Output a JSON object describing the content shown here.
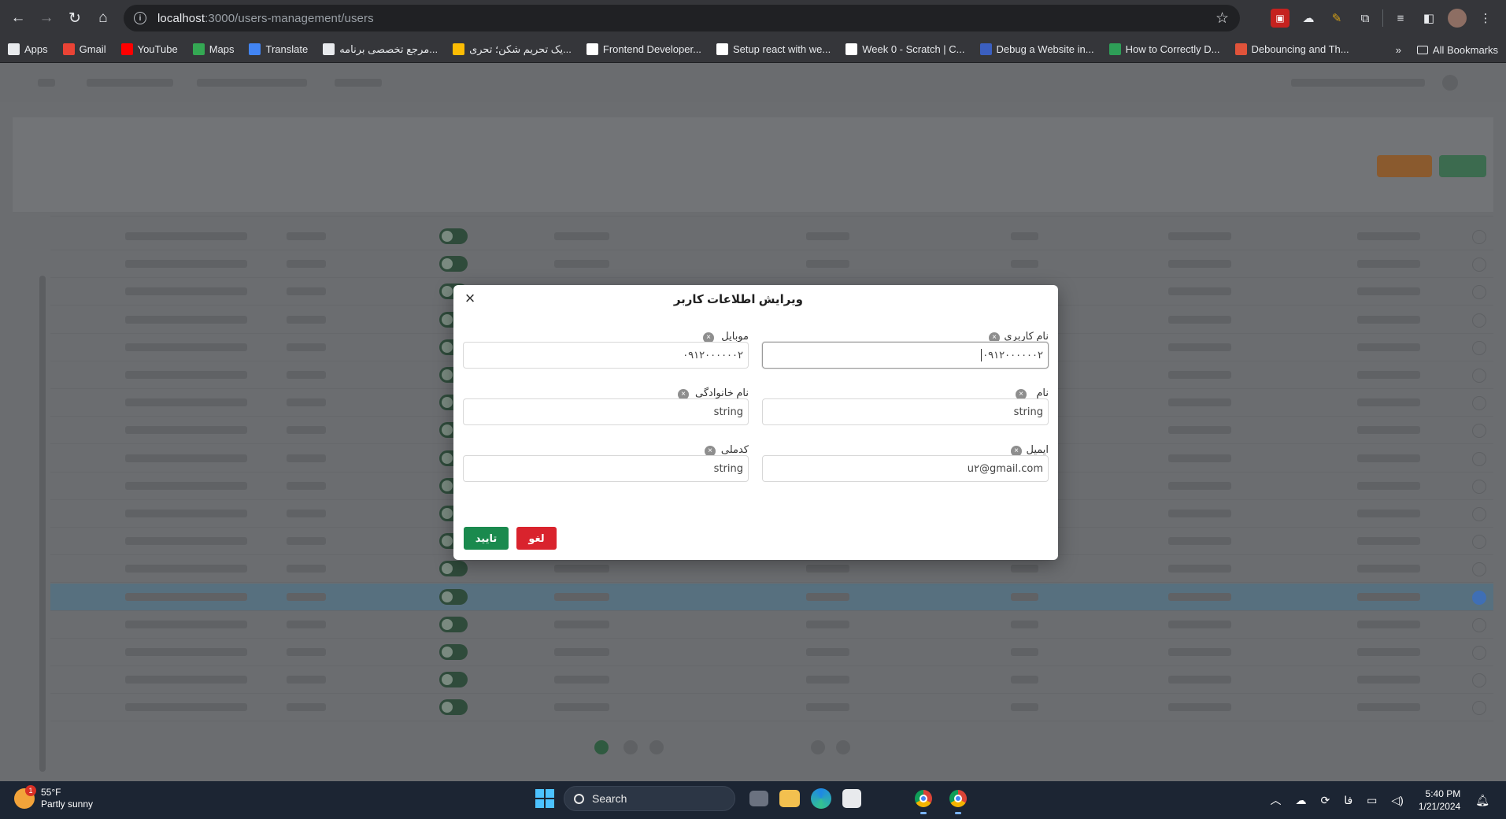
{
  "browser": {
    "url_host": "localhost",
    "url_path": ":3000/users-management/users",
    "nav": {
      "back": "←",
      "forward": "→",
      "reload": "↻",
      "home": "⌂"
    },
    "bookmarks": [
      {
        "label": "Apps",
        "icon": "apps-grid-icon",
        "color": "#e8eaed"
      },
      {
        "label": "Gmail",
        "icon": "gmail-icon",
        "color": "#ea4335"
      },
      {
        "label": "YouTube",
        "icon": "youtube-icon",
        "color": "#ff0000"
      },
      {
        "label": "Maps",
        "icon": "maps-icon",
        "color": "#34a853"
      },
      {
        "label": "Translate",
        "icon": "translate-icon",
        "color": "#4285f4"
      },
      {
        "label": "مرجع تخصصی برنامه...",
        "icon": "site-icon",
        "color": "#e8eaed"
      },
      {
        "label": "یک تحریم شکن؛ تحری...",
        "icon": "site-icon",
        "color": "#fbbc04"
      },
      {
        "label": "Frontend Developer...",
        "icon": "frontend-icon",
        "color": "#ffffff"
      },
      {
        "label": "Setup react with we...",
        "icon": "medium-icon",
        "color": "#ffffff"
      },
      {
        "label": "Week 0 - Scratch | C...",
        "icon": "x-icon",
        "color": "#ffffff"
      },
      {
        "label": "Debug a Website in...",
        "icon": "wd-icon",
        "color": "#3b5fc0"
      },
      {
        "label": "How to Correctly D...",
        "icon": "dp-icon",
        "color": "#2e9e57"
      },
      {
        "label": "Debouncing and Th...",
        "icon": "asterisk-icon",
        "color": "#e0533a"
      }
    ],
    "all_bookmarks": "All Bookmarks"
  },
  "modal": {
    "title": "ویرایش اطلاعات کاربر",
    "close": "×",
    "fields": {
      "username": {
        "label": "نام کاربری",
        "value": "۰۹۱۲۰۰۰۰۰۰۲"
      },
      "mobile": {
        "label": "موبایل",
        "value": "۰۹۱۲۰۰۰۰۰۰۲"
      },
      "first_name": {
        "label": "نام",
        "value": "string"
      },
      "last_name": {
        "label": "نام خانوادگی",
        "value": "string"
      },
      "email": {
        "label": "ایمیل",
        "value": "u۲@gmail.com"
      },
      "national_code": {
        "label": "کدملی",
        "value": "string"
      }
    },
    "confirm": "تایید",
    "cancel": "لغو"
  },
  "taskbar": {
    "weather_temp": "55°F",
    "weather_desc": "Partly sunny",
    "weather_badge": "1",
    "search": "Search",
    "lang": "فا",
    "time": "5:40 PM",
    "date": "1/21/2024"
  },
  "colors": {
    "confirm": "#1a8a4e",
    "cancel": "#d9232d"
  }
}
